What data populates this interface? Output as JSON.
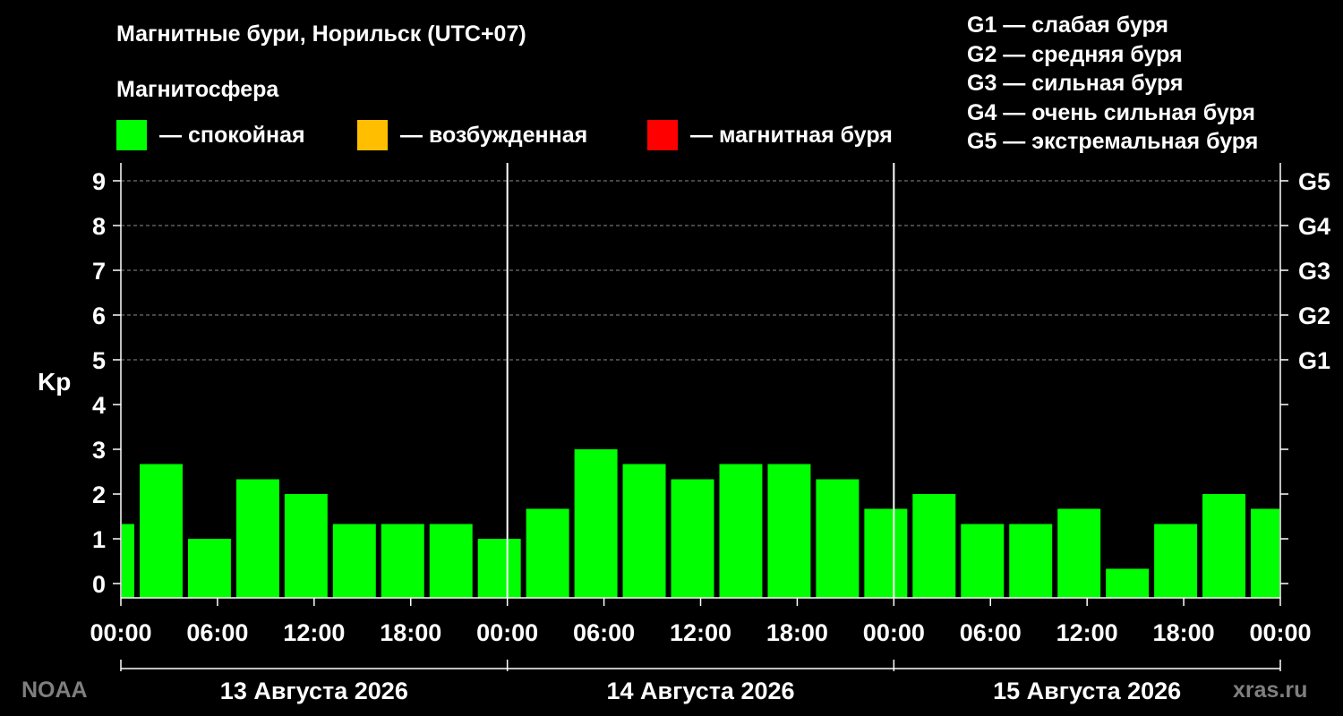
{
  "chart_data": {
    "type": "bar",
    "title": "Магнитные бури, Норильск (UTC+07)",
    "legend_title": "Магнитосфера",
    "legend": [
      {
        "label": "— спокойная",
        "color": "#00ff00"
      },
      {
        "label": "— возбужденная",
        "color": "#ffbf00"
      },
      {
        "label": "— магнитная буря",
        "color": "#ff0000"
      }
    ],
    "g_legend": [
      "G1 — слабая буря",
      "G2 — средняя буря",
      "G3 — сильная буря",
      "G4 — очень сильная буря",
      "G5 — экстремальная буря"
    ],
    "ylabel": "Kp",
    "ylim": [
      0,
      9
    ],
    "yticks": [
      "0",
      "1",
      "2",
      "3",
      "4",
      "5",
      "6",
      "7",
      "8",
      "9"
    ],
    "g_levels": [
      {
        "kp": 5,
        "label": "G1"
      },
      {
        "kp": 6,
        "label": "G2"
      },
      {
        "kp": 7,
        "label": "G3"
      },
      {
        "kp": 8,
        "label": "G4"
      },
      {
        "kp": 9,
        "label": "G5"
      }
    ],
    "grid_levels": [
      5,
      6,
      7,
      8,
      9
    ],
    "x_hours": 72,
    "xticks": [
      {
        "hour": 0,
        "label": "00:00"
      },
      {
        "hour": 6,
        "label": "06:00"
      },
      {
        "hour": 12,
        "label": "12:00"
      },
      {
        "hour": 18,
        "label": "18:00"
      },
      {
        "hour": 24,
        "label": "00:00"
      },
      {
        "hour": 30,
        "label": "06:00"
      },
      {
        "hour": 36,
        "label": "12:00"
      },
      {
        "hour": 42,
        "label": "18:00"
      },
      {
        "hour": 48,
        "label": "00:00"
      },
      {
        "hour": 54,
        "label": "06:00"
      },
      {
        "hour": 60,
        "label": "12:00"
      },
      {
        "hour": 66,
        "label": "18:00"
      },
      {
        "hour": 72,
        "label": "00:00"
      }
    ],
    "days": [
      {
        "start": 0,
        "end": 24,
        "label": "13 Августа 2026"
      },
      {
        "start": 24,
        "end": 48,
        "label": "14 Августа 2026"
      },
      {
        "start": 48,
        "end": 72,
        "label": "15 Августа 2026"
      }
    ],
    "bars": [
      {
        "start": 0,
        "end": 1,
        "kp": 1.33
      },
      {
        "start": 1,
        "end": 4,
        "kp": 2.67
      },
      {
        "start": 4,
        "end": 7,
        "kp": 1.0
      },
      {
        "start": 7,
        "end": 10,
        "kp": 2.33
      },
      {
        "start": 10,
        "end": 13,
        "kp": 2.0
      },
      {
        "start": 13,
        "end": 16,
        "kp": 1.33
      },
      {
        "start": 16,
        "end": 19,
        "kp": 1.33
      },
      {
        "start": 19,
        "end": 22,
        "kp": 1.33
      },
      {
        "start": 22,
        "end": 25,
        "kp": 1.0
      },
      {
        "start": 25,
        "end": 28,
        "kp": 1.67
      },
      {
        "start": 28,
        "end": 31,
        "kp": 3.0
      },
      {
        "start": 31,
        "end": 34,
        "kp": 2.67
      },
      {
        "start": 34,
        "end": 37,
        "kp": 2.33
      },
      {
        "start": 37,
        "end": 40,
        "kp": 2.67
      },
      {
        "start": 40,
        "end": 43,
        "kp": 2.67
      },
      {
        "start": 43,
        "end": 46,
        "kp": 2.33
      },
      {
        "start": 46,
        "end": 49,
        "kp": 1.67
      },
      {
        "start": 49,
        "end": 52,
        "kp": 2.0
      },
      {
        "start": 52,
        "end": 55,
        "kp": 1.33
      },
      {
        "start": 55,
        "end": 58,
        "kp": 1.33
      },
      {
        "start": 58,
        "end": 61,
        "kp": 1.67
      },
      {
        "start": 61,
        "end": 64,
        "kp": 0.33
      },
      {
        "start": 64,
        "end": 67,
        "kp": 1.33
      },
      {
        "start": 67,
        "end": 70,
        "kp": 2.0
      },
      {
        "start": 70,
        "end": 72,
        "kp": 1.67
      }
    ]
  },
  "footer": {
    "source_left": "NOAA",
    "source_right": "xras.ru"
  }
}
